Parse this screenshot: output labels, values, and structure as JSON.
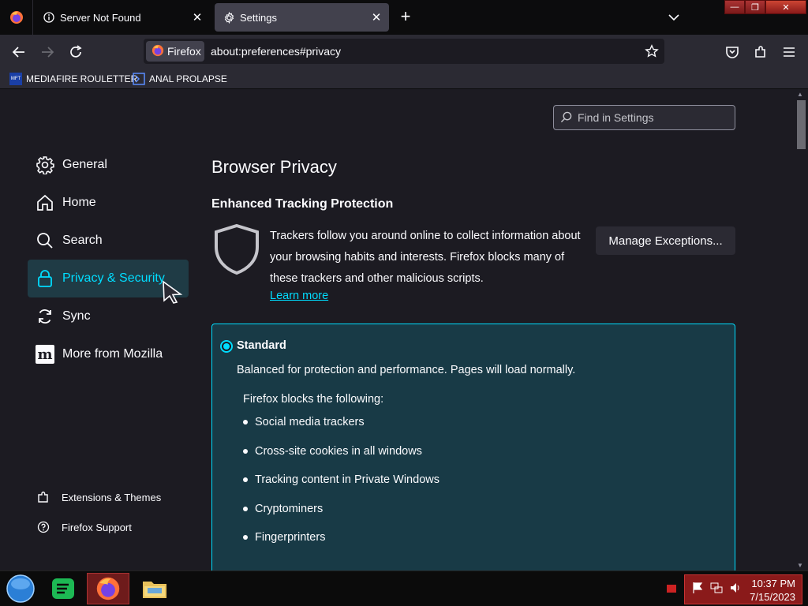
{
  "browser": {
    "tabs": [
      {
        "title": "Server Not Found",
        "active": false
      },
      {
        "title": "Settings",
        "active": true
      }
    ],
    "identity_label": "Firefox",
    "url": "about:preferences#privacy",
    "bookmarks": [
      {
        "label": "MEDIAFIRE ROULETTER",
        "icon_text": "MFT"
      },
      {
        "label": "ANAL PROLAPSE"
      }
    ]
  },
  "settings": {
    "search_placeholder": "Find in Settings",
    "categories": [
      {
        "label": "General",
        "icon": "gear-icon"
      },
      {
        "label": "Home",
        "icon": "home-icon"
      },
      {
        "label": "Search",
        "icon": "search-icon"
      },
      {
        "label": "Privacy & Security",
        "icon": "lock-icon",
        "selected": true
      },
      {
        "label": "Sync",
        "icon": "sync-icon"
      },
      {
        "label": "More from Mozilla",
        "icon": "mozilla-icon",
        "icon_text": "m"
      }
    ],
    "footer": [
      {
        "label": "Extensions & Themes",
        "icon": "puzzle-icon"
      },
      {
        "label": "Firefox Support",
        "icon": "help-icon"
      }
    ],
    "section_title": "Browser Privacy",
    "etp_title": "Enhanced Tracking Protection",
    "etp_description": "Trackers follow you around online to collect information about your browsing habits and interests. Firefox blocks many of these trackers and other malicious scripts.",
    "learn_more": "Learn more",
    "manage_exceptions": "Manage Exceptions...",
    "standard": {
      "title": "Standard",
      "description": "Balanced for protection and performance. Pages will load normally.",
      "blocks_heading": "Firefox blocks the following:",
      "items": [
        "Social media trackers",
        "Cross-site cookies in all windows",
        "Tracking content in Private Windows",
        "Cryptominers",
        "Fingerprinters"
      ]
    }
  },
  "taskbar": {
    "time": "10:37 PM",
    "date": "7/15/2023"
  },
  "colors": {
    "accent": "#00ddff",
    "background": "#1c1b22",
    "selected_bg": "#1f3b45",
    "panel_bg": "#183a46"
  }
}
